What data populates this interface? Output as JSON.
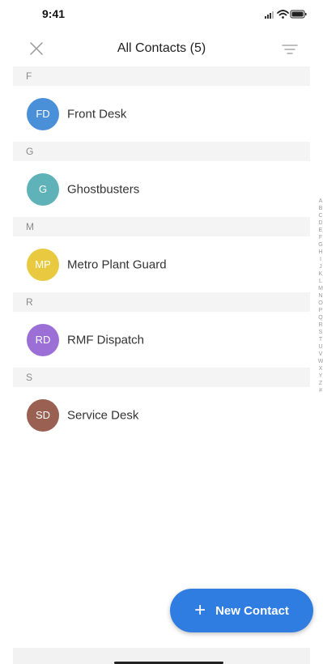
{
  "status_bar": {
    "time": "9:41",
    "icons": [
      "cellular-signal-icon",
      "wifi-icon",
      "battery-icon"
    ]
  },
  "header": {
    "title": "All Contacts (5)",
    "close_icon": "close-icon",
    "filter_icon": "filter-icon"
  },
  "sections": [
    {
      "letter": "F",
      "contacts": [
        {
          "initials": "FD",
          "name": "Front Desk",
          "color": "#4a90d9"
        }
      ]
    },
    {
      "letter": "G",
      "contacts": [
        {
          "initials": "G",
          "name": "Ghostbusters",
          "color": "#5fb3b8"
        }
      ]
    },
    {
      "letter": "M",
      "contacts": [
        {
          "initials": "MP",
          "name": "Metro Plant Guard",
          "color": "#e8c940"
        }
      ]
    },
    {
      "letter": "R",
      "contacts": [
        {
          "initials": "RD",
          "name": "RMF Dispatch",
          "color": "#9b6fd6"
        }
      ]
    },
    {
      "letter": "S",
      "contacts": [
        {
          "initials": "SD",
          "name": "Service Desk",
          "color": "#9a6052"
        }
      ]
    }
  ],
  "alphabet_index": [
    "A",
    "B",
    "C",
    "D",
    "E",
    "F",
    "G",
    "H",
    "I",
    "J",
    "K",
    "L",
    "M",
    "N",
    "O",
    "P",
    "Q",
    "R",
    "S",
    "T",
    "U",
    "V",
    "W",
    "X",
    "Y",
    "Z",
    "#"
  ],
  "fab": {
    "icon": "plus-icon",
    "label": "New Contact",
    "color": "#2f7de1"
  }
}
